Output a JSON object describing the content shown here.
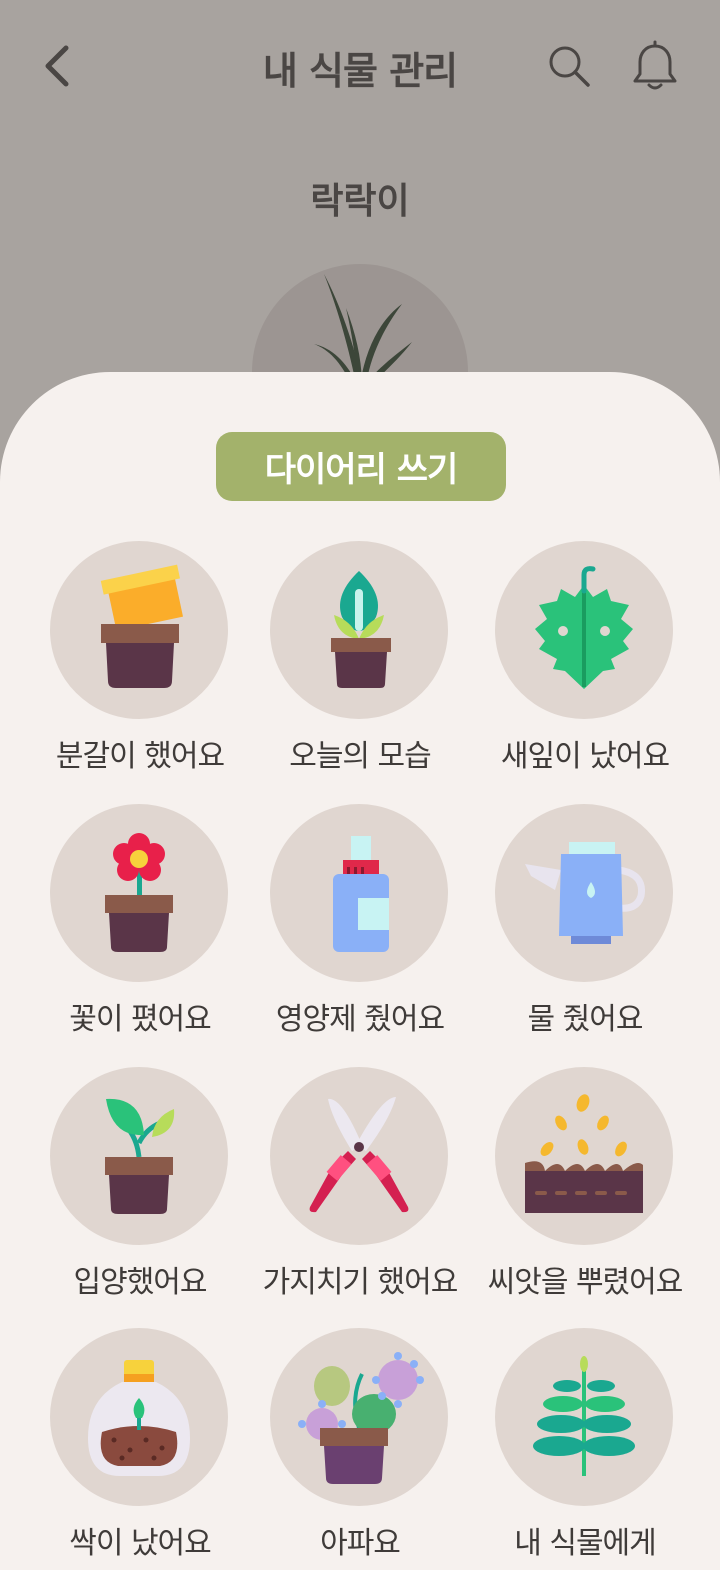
{
  "header": {
    "title": "내 식물 관리",
    "back_icon": "chevron-left-icon",
    "search_icon": "search-icon",
    "bell_icon": "bell-icon"
  },
  "plant": {
    "name": "락락이"
  },
  "diary_button": {
    "label": "다이어리 쓰기",
    "color": "#a3b26b"
  },
  "actions": [
    {
      "label": "분갈이 했어요",
      "icon": "repot-icon"
    },
    {
      "label": "오늘의 모습",
      "icon": "sprout-pot-icon"
    },
    {
      "label": "새잎이 났어요",
      "icon": "monstera-leaf-icon"
    },
    {
      "label": "꽃이 폈어요",
      "icon": "flower-pot-icon"
    },
    {
      "label": "영양제 줬어요",
      "icon": "spray-bottle-icon"
    },
    {
      "label": "물 줬어요",
      "icon": "watering-can-icon"
    },
    {
      "label": "입양했어요",
      "icon": "seedling-pot-icon"
    },
    {
      "label": "가지치기 했어요",
      "icon": "pruning-shears-icon"
    },
    {
      "label": "씨앗을 뿌렸어요",
      "icon": "seeds-icon"
    },
    {
      "label": "싹이 났어요",
      "icon": "terrarium-icon"
    },
    {
      "label": "아파요",
      "icon": "sick-plant-icon"
    },
    {
      "label": "내 식물에게",
      "icon": "herb-icon"
    }
  ]
}
